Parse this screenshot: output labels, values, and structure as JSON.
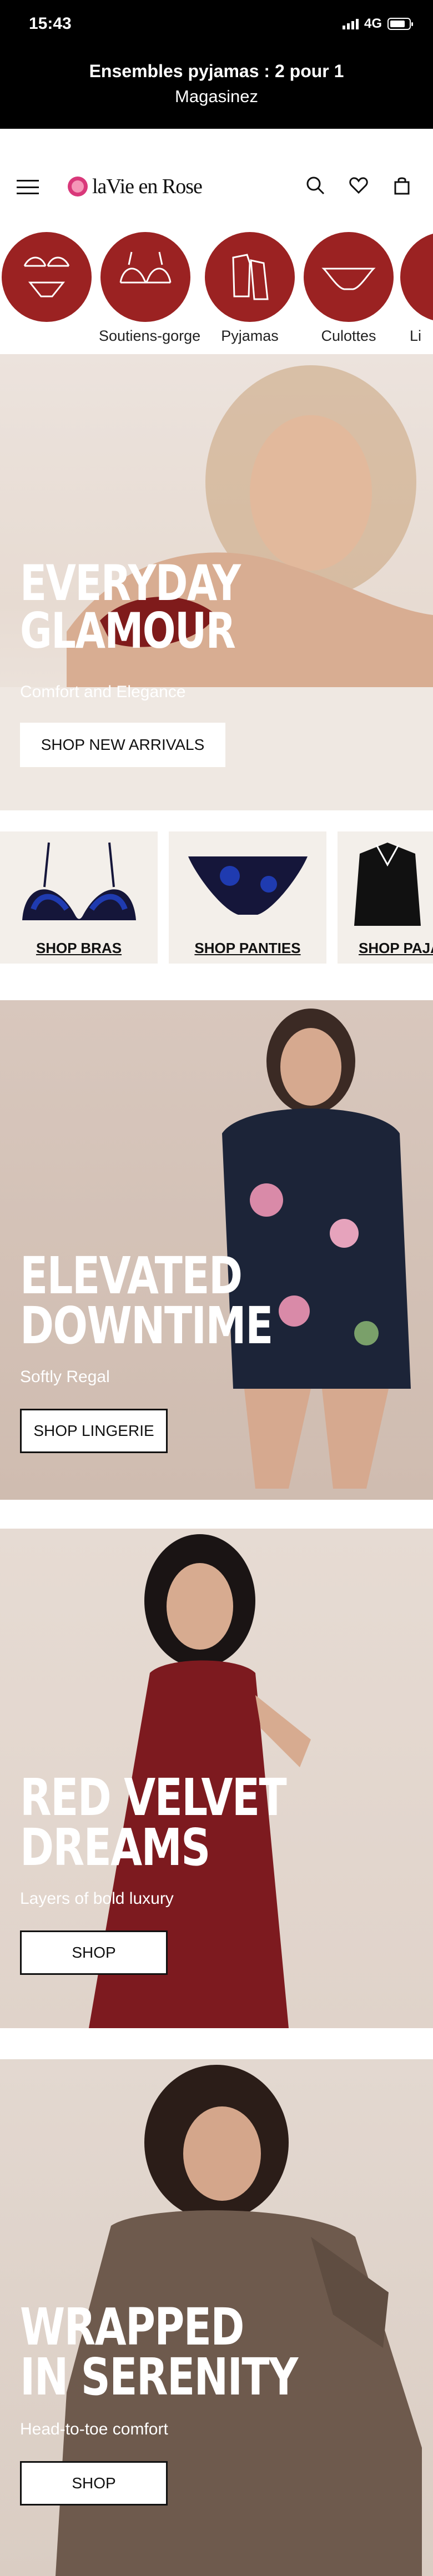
{
  "status": {
    "time": "15:43",
    "network": "4G"
  },
  "promo": {
    "title": "Ensembles pyjamas : 2 pour 1",
    "subtitle": "Magasinez"
  },
  "brand": {
    "name": "laVie en Rose"
  },
  "icons": {
    "menu": "hamburger-menu-icon",
    "search": "search-icon",
    "wishlist": "heart-icon",
    "bag": "shopping-bag-icon"
  },
  "categories": [
    {
      "label": "",
      "icon": "lingerie-set-icon"
    },
    {
      "label": "Soutiens-gorge",
      "icon": "bra-icon"
    },
    {
      "label": "Pyjamas",
      "icon": "pyjama-icon"
    },
    {
      "label": "Culottes",
      "icon": "panties-icon"
    },
    {
      "label": "Li",
      "icon": "lingerie-icon"
    }
  ],
  "banners": {
    "everyday": {
      "title_line1": "EVERYDAY",
      "title_line2": "GLAMOUR",
      "subtitle": "Comfort and Elegance",
      "button": "SHOP NEW ARRIVALS"
    },
    "elevated": {
      "title_line1": "ELEVATED",
      "title_line2": "DOWNTIME",
      "subtitle": "Softly Regal",
      "button": "SHOP LINGERIE"
    },
    "velvet": {
      "title_line1": "RED VELVET",
      "title_line2": "DREAMS",
      "subtitle": "Layers of bold luxury",
      "button": "SHOP"
    },
    "wrapped": {
      "title_line1": "WRAPPED",
      "title_line2": "IN SERENITY",
      "subtitle": "Head-to-toe comfort",
      "button": "SHOP"
    }
  },
  "product_tiles": [
    {
      "label": "SHOP BRAS"
    },
    {
      "label": "SHOP PANTIES"
    },
    {
      "label": "SHOP PAJA"
    }
  ],
  "colors": {
    "accent": "#9b2222",
    "black": "#000000"
  }
}
